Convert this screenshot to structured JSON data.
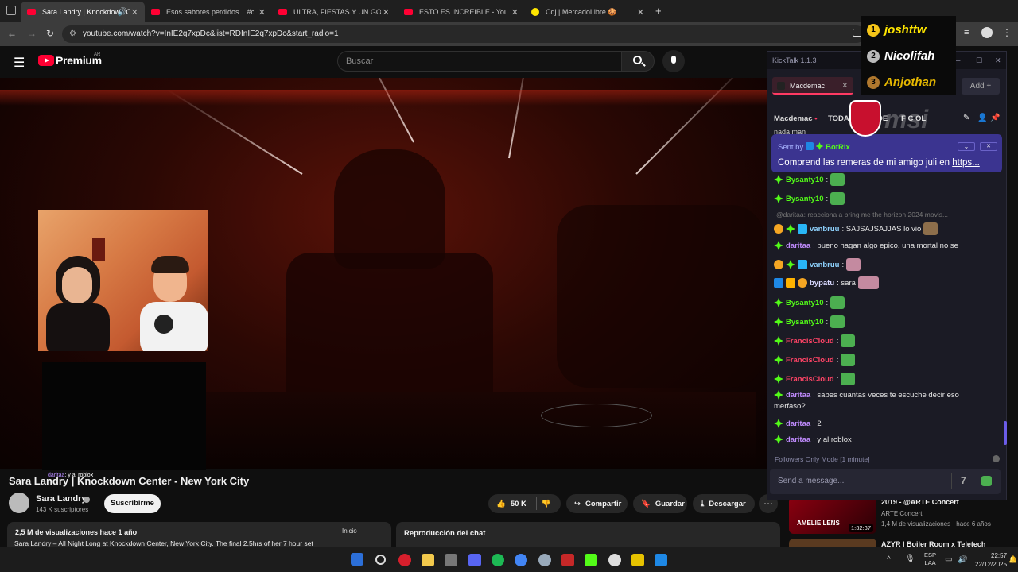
{
  "browser": {
    "tabs": [
      {
        "label": "Sara Landry | Knockdown C",
        "active": true
      },
      {
        "label": "Esos sabores perdidos... #comi"
      },
      {
        "label": "ULTRA, FIESTAS Y UN GORDO I"
      },
      {
        "label": "ESTO ES INCREIBLE - YouTube"
      },
      {
        "label": "Cdj | MercadoLibre 🍪"
      }
    ],
    "new_tab": "+",
    "url": "youtube.com/watch?v=InIE2q7xpDc&list=RDInIE2q7xpDc&start_radio=1"
  },
  "youtube": {
    "logo": "Premium",
    "region": "AR",
    "search_placeholder": "Buscar",
    "video_title": "Sara Landry | Knockdown Center - New York City",
    "channel": "Sara Landry",
    "subscribers": "143 K suscriptores",
    "subscribe": "Suscribirme",
    "likes": "50 K",
    "share": "Compartir",
    "save": "Guardar",
    "download": "Descargar",
    "views": "2,5 M de visualizaciones  hace 1 año",
    "description": "Sara Landry – All Night Long at Knockdown Center, New York City.  The final 2.5hrs of her 7 hour set",
    "inicio": "Inicio",
    "chat_replay": "Reproducción del chat",
    "cam_caption_user": "daritaa",
    "cam_caption_text": ": y al roblox"
  },
  "sidebar_recs": [
    {
      "title": "2019 - @ARTE Concert",
      "channel": "ARTE Concert",
      "meta": "1,4 M de visualizaciones · hace 6 años",
      "thumb_text": "AMELIE LENS",
      "duration": "1:32:37"
    },
    {
      "title": "AZYR | Boiler Room x Teletech"
    }
  ],
  "kicktalk": {
    "title": "KickTalk 1.1.3",
    "channel_tab": "Macdemac",
    "add": "Add",
    "filter_channel": "Macdemac",
    "filter_all": "TODA",
    "filter_de": "DE",
    "filter_fc": "F C  OL",
    "partial_top": "nada man",
    "pinned_sent_by": "Sent by",
    "pinned_bot": "BotRix",
    "pinned_msg": "Comprend las remeras de mi amigo juli en",
    "pinned_link": "https...",
    "reply_line": "@daritaa: reacciona a bring me the horizon 2024 movis...",
    "messages": [
      {
        "user": "Bysanty10",
        "text": ":"
      },
      {
        "user": "Bysanty10",
        "text": ":"
      },
      {
        "user": "vanbruu",
        "text": ": SAJSAJSAJJAS lo vio"
      },
      {
        "user": "daritaa",
        "text": ": bueno hagan algo epico, una mortal no se"
      },
      {
        "user": "vanbruu",
        "text": ":"
      },
      {
        "user": "bypatu",
        "text": ": sara"
      },
      {
        "user": "Bysanty10",
        "text": ":"
      },
      {
        "user": "Bysanty10",
        "text": ":"
      },
      {
        "user": "FrancisCloud",
        "text": ":"
      },
      {
        "user": "FrancisCloud",
        "text": ":"
      },
      {
        "user": "FrancisCloud",
        "text": ":"
      },
      {
        "user": "daritaa",
        "text": ": sabes cuantas veces te escuche decir eso"
      },
      {
        "user": "",
        "text": "merfaso?"
      },
      {
        "user": "daritaa",
        "text": ": 2"
      },
      {
        "user": "daritaa",
        "text": ": y al roblox"
      }
    ],
    "mode": "Followers Only Mode [1 minute]",
    "input_placeholder": "Send a message..."
  },
  "leaderboard": [
    {
      "rank": "1",
      "name": "joshttw"
    },
    {
      "rank": "2",
      "name": "Nicolifah"
    },
    {
      "rank": "3",
      "name": "Anjothan"
    }
  ],
  "overlay_brand": "msi",
  "tray": {
    "lang1": "ESP",
    "lang2": "LAA",
    "time": "22:57",
    "date": "22/12/2025"
  },
  "colors": {
    "kick_green": "#53fc18",
    "yt_red": "#ff0033",
    "accent_purple": "#6b5ce7"
  }
}
